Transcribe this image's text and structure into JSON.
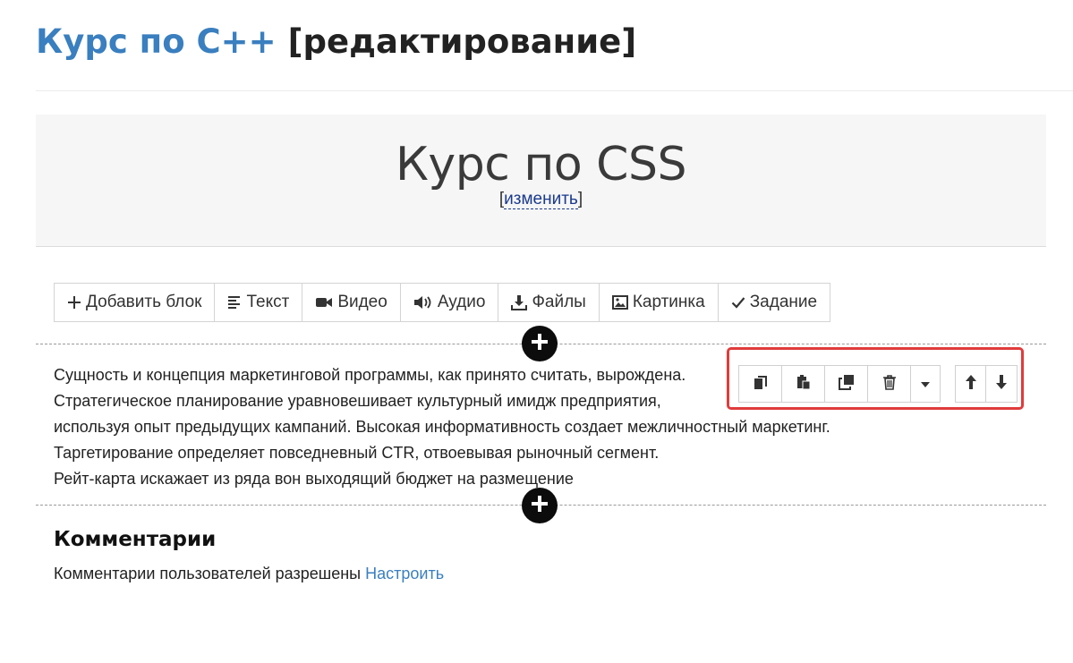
{
  "header": {
    "course_title": "Курс по C++",
    "mode_label": "[редактирование]"
  },
  "hero": {
    "title": "Курс по CSS",
    "edit_open": "[",
    "edit_link": "изменить",
    "edit_close": "]"
  },
  "toolbar": {
    "buttons": [
      {
        "label": "Добавить блок",
        "icon": "plus-icon"
      },
      {
        "label": "Текст",
        "icon": "align-left-icon"
      },
      {
        "label": "Видео",
        "icon": "video-camera-icon"
      },
      {
        "label": "Аудио",
        "icon": "speaker-icon"
      },
      {
        "label": "Файлы",
        "icon": "download-icon"
      },
      {
        "label": "Картинка",
        "icon": "image-icon"
      },
      {
        "label": "Задание",
        "icon": "checkmark-icon"
      }
    ]
  },
  "text_block": {
    "lines": [
      "Сущность и концепция маркетинговой программы, как принято считать, вырождена.",
      "Стратегическое планирование уравновешивает культурный имидж предприятия,",
      "используя опыт предыдущих кампаний. Высокая информативность создает межличностный маркетинг.",
      "Таргетирование определяет повседневный CTR, отвоевывая рыночный сегмент.",
      "Рейт-карта искажает из ряда вон выходящий бюджет на размещение"
    ]
  },
  "block_actions": {
    "icons": [
      "copy-icon",
      "paste-icon",
      "duplicate-icon",
      "trash-icon",
      "caret-down-icon",
      "arrow-up-icon",
      "arrow-down-icon"
    ],
    "highlight_color": "#e03b3b"
  },
  "comments": {
    "title": "Комментарии",
    "status": "Комментарии пользователей разрешены",
    "configure_link": "Настроить"
  },
  "colors": {
    "accent": "#3a7fbf",
    "add_circle": "#0c0c0c"
  }
}
